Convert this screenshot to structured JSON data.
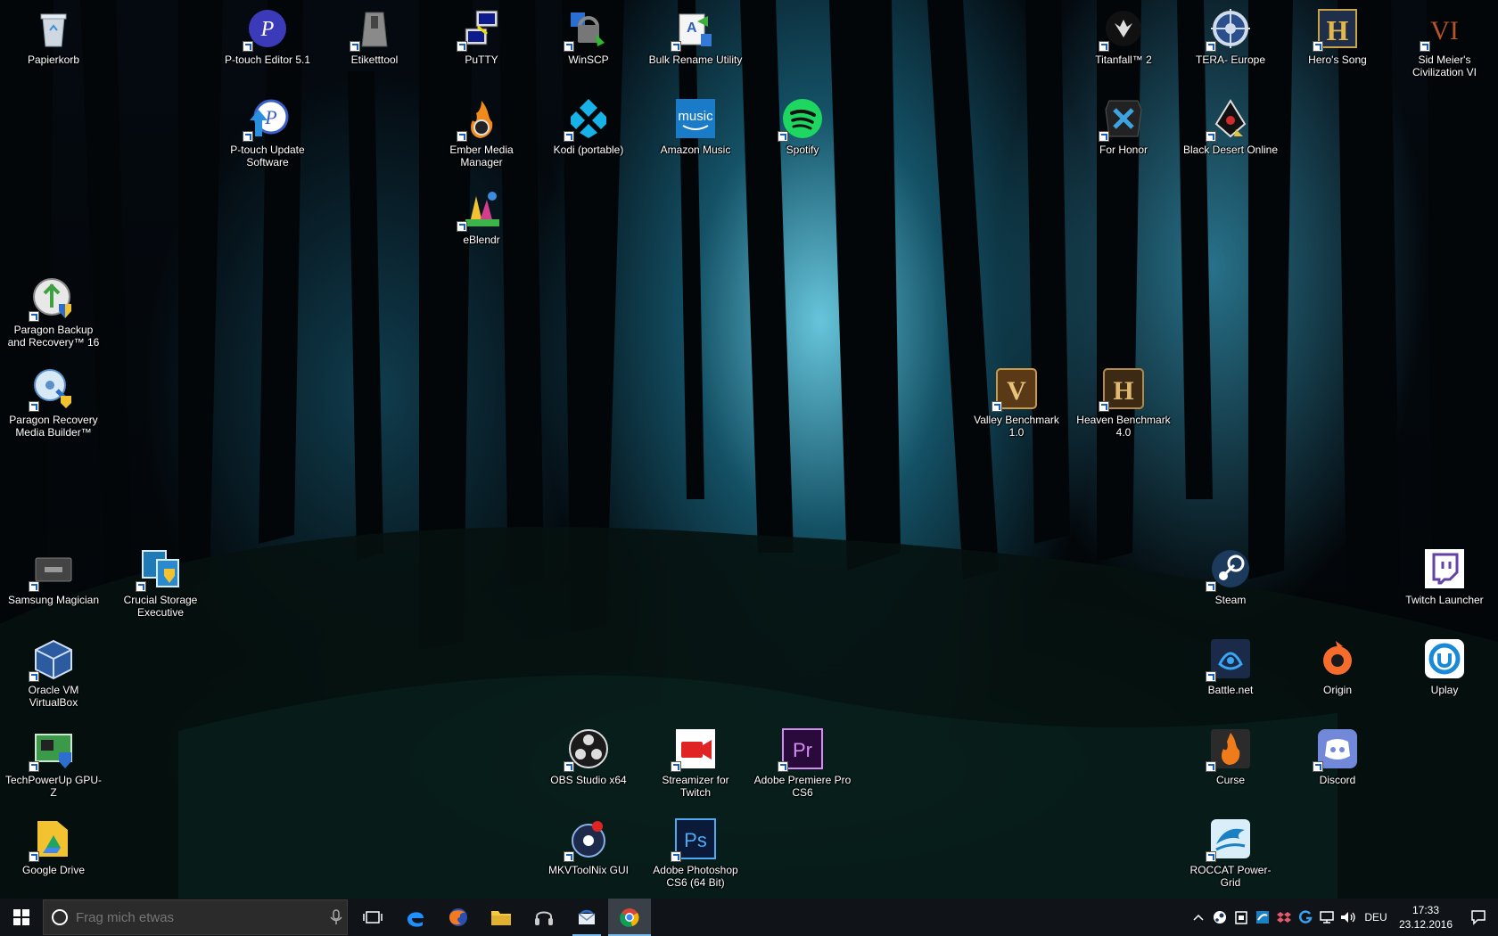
{
  "desktop": {
    "icons": [
      {
        "label": "Papierkorb",
        "icon": "recycle-bin-icon"
      },
      {
        "label": "P-touch Editor 5.1",
        "icon": "ptouch-editor-icon"
      },
      {
        "label": "Etiketttool",
        "icon": "etiketttool-icon"
      },
      {
        "label": "PuTTY",
        "icon": "putty-icon"
      },
      {
        "label": "WinSCP",
        "icon": "winscp-icon"
      },
      {
        "label": "Bulk Rename Utility",
        "icon": "bulk-rename-icon"
      },
      {
        "label": "Titanfall™ 2",
        "icon": "titanfall-icon"
      },
      {
        "label": "TERA- Europe",
        "icon": "tera-icon"
      },
      {
        "label": "Hero's Song",
        "icon": "heros-song-icon",
        "glyph": "H"
      },
      {
        "label": "Sid Meier's Civilization VI",
        "icon": "civilization-icon",
        "glyph": "VI"
      },
      {
        "label": "P-touch Update Software",
        "icon": "ptouch-update-icon"
      },
      {
        "label": "Ember Media Manager",
        "icon": "ember-icon"
      },
      {
        "label": "Kodi (portable)",
        "icon": "kodi-icon"
      },
      {
        "label": "Amazon Music",
        "icon": "amazon-music-icon",
        "glyph": "music"
      },
      {
        "label": "Spotify",
        "icon": "spotify-icon"
      },
      {
        "label": "For Honor",
        "icon": "for-honor-icon"
      },
      {
        "label": "Black Desert Online",
        "icon": "black-desert-icon"
      },
      {
        "label": "eBlendr",
        "icon": "eblendr-icon"
      },
      {
        "label": "Paragon Backup and Recovery™ 16",
        "icon": "paragon-backup-icon"
      },
      {
        "label": "Paragon Recovery Media Builder™",
        "icon": "paragon-media-icon"
      },
      {
        "label": "Valley Benchmark 1.0",
        "icon": "valley-benchmark-icon",
        "glyph": "V"
      },
      {
        "label": "Heaven Benchmark 4.0",
        "icon": "heaven-benchmark-icon",
        "glyph": "H"
      },
      {
        "label": "Samsung Magician",
        "icon": "samsung-magician-icon"
      },
      {
        "label": "Crucial Storage Executive",
        "icon": "crucial-icon"
      },
      {
        "label": "Steam",
        "icon": "steam-icon"
      },
      {
        "label": "Twitch Launcher",
        "icon": "twitch-icon"
      },
      {
        "label": "Oracle VM VirtualBox",
        "icon": "virtualbox-icon"
      },
      {
        "label": "Battle.net",
        "icon": "battlenet-icon"
      },
      {
        "label": "Origin",
        "icon": "origin-icon"
      },
      {
        "label": "Uplay",
        "icon": "uplay-icon"
      },
      {
        "label": "TechPowerUp GPU-Z",
        "icon": "gpuz-icon"
      },
      {
        "label": "OBS Studio x64",
        "icon": "obs-icon"
      },
      {
        "label": "Streamizer for Twitch",
        "icon": "streamizer-icon"
      },
      {
        "label": "Adobe Premiere Pro CS6",
        "icon": "premiere-icon",
        "glyph": "Pr"
      },
      {
        "label": "Curse",
        "icon": "curse-icon"
      },
      {
        "label": "Discord",
        "icon": "discord-icon"
      },
      {
        "label": "Google Drive",
        "icon": "google-drive-icon"
      },
      {
        "label": "MKVToolNix GUI",
        "icon": "mkvtoolnix-icon"
      },
      {
        "label": "Adobe Photoshop CS6 (64 Bit)",
        "icon": "photoshop-icon",
        "glyph": "Ps"
      },
      {
        "label": "ROCCAT Power-Grid",
        "icon": "roccat-icon"
      }
    ]
  },
  "taskbar": {
    "search_placeholder": "Frag mich etwas",
    "pinned": [
      {
        "name": "task-view",
        "icon": "task-view-icon"
      },
      {
        "name": "edge",
        "icon": "edge-icon"
      },
      {
        "name": "firefox",
        "icon": "firefox-icon"
      },
      {
        "name": "file-explorer",
        "icon": "folder-icon"
      },
      {
        "name": "headset-app",
        "icon": "headset-icon"
      },
      {
        "name": "thunderbird",
        "icon": "thunderbird-icon"
      },
      {
        "name": "chrome",
        "icon": "chrome-icon"
      }
    ],
    "tray": {
      "icons": [
        "chevron-up-icon",
        "steam-tray-icon",
        "security-icon",
        "roccat-tray-icon",
        "dropbox-tray-icon",
        "g-tray-icon",
        "network-icon",
        "volume-icon"
      ],
      "language": "DEU",
      "time": "17:33",
      "date": "23.12.2016"
    }
  }
}
